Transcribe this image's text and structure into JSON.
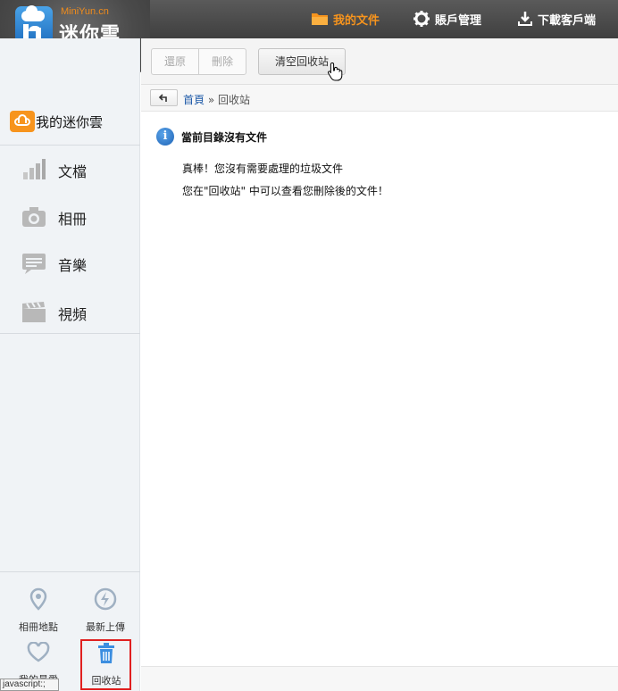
{
  "app": {
    "logo_sub": "MiniYun.cn",
    "logo_main": "迷你雲"
  },
  "topnav": [
    {
      "label": "我的文件",
      "icon": "folder-icon",
      "active": true
    },
    {
      "label": "賬戶管理",
      "icon": "gear-icon",
      "active": false
    },
    {
      "label": "下載客戶端",
      "icon": "download-icon",
      "active": false
    }
  ],
  "toolbar": {
    "restore_label": "還原",
    "delete_label": "刪除",
    "clear_label": "清空回收站"
  },
  "breadcrumb": {
    "home": "首頁",
    "separator": "»",
    "current": "回收站"
  },
  "sidebar": {
    "root_label": "我的迷你雲",
    "items": [
      {
        "label": "文檔",
        "icon": "document-chart-icon"
      },
      {
        "label": "相冊",
        "icon": "camera-icon"
      },
      {
        "label": "音樂",
        "icon": "music-icon"
      },
      {
        "label": "視頻",
        "icon": "video-icon"
      }
    ],
    "bottom": [
      {
        "label": "相冊地點",
        "icon": "location-icon"
      },
      {
        "label": "最新上傳",
        "icon": "lightning-icon"
      },
      {
        "label": "我的最愛",
        "icon": "heart-icon"
      },
      {
        "label": "回收站",
        "icon": "trash-icon"
      }
    ]
  },
  "message": {
    "title": "當前目錄沒有文件",
    "line1": "真棒！您沒有需要處理的垃圾文件",
    "line2": "您在\"回收站\" 中可以查看您刪除後的文件！"
  },
  "status_bar": "javascript:;",
  "colors": {
    "accent": "#f7941d",
    "topbar": "#4a4a4a",
    "link": "#1e5aa8",
    "highlight": "#e02020"
  }
}
